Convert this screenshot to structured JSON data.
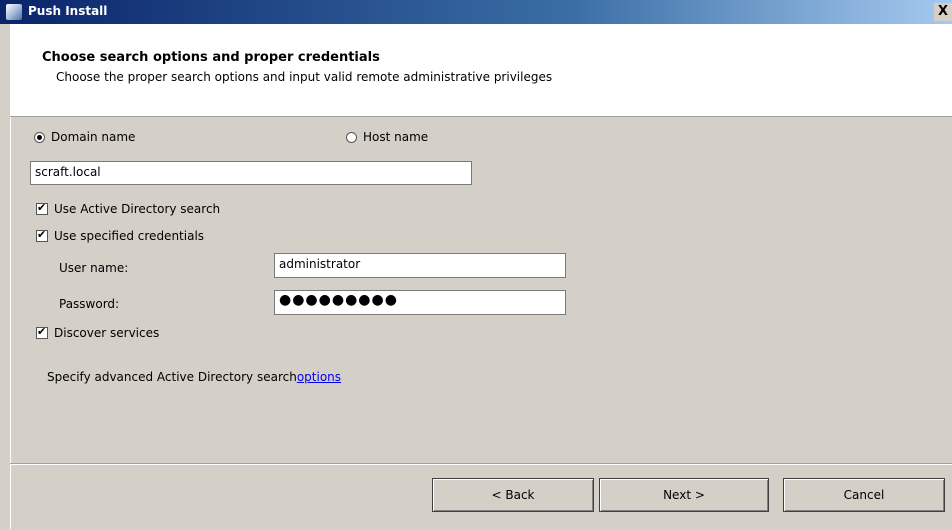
{
  "window": {
    "title": "Push Install",
    "close_glyph": "X"
  },
  "header": {
    "title": "Choose search options and proper credentials",
    "subtitle": "Choose the proper search options and input valid remote administrative privileges"
  },
  "search_type": {
    "domain_label": "Domain name",
    "host_label": "Host name",
    "selected": "domain"
  },
  "domain_value": "scraft.local",
  "options": {
    "use_ad_search": {
      "label": "Use Active Directory search",
      "checked": true
    },
    "use_credentials": {
      "label": "Use specified credentials",
      "checked": true
    },
    "discover_services": {
      "label": "Discover services",
      "checked": true
    }
  },
  "credentials": {
    "user_label": "User name:",
    "user_value": "administrator",
    "password_label": "Password:",
    "password_mask": "●●●●●●●●●"
  },
  "advanced": {
    "text": "Specify advanced Active Directory search ",
    "link": "options"
  },
  "buttons": {
    "back": "< Back",
    "next": "Next >",
    "cancel": "Cancel"
  }
}
